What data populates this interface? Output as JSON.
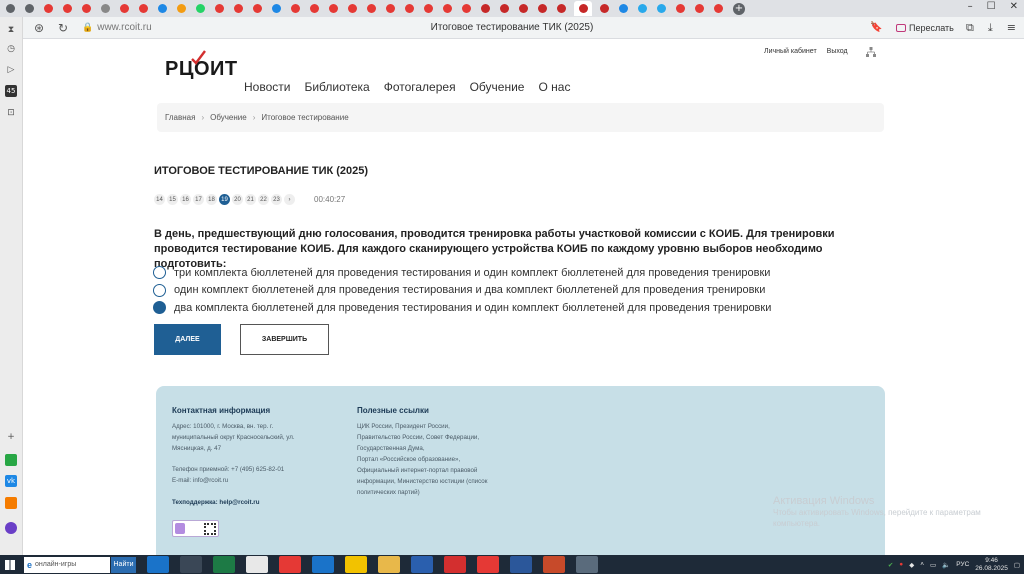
{
  "browser": {
    "tabs": [
      {
        "icon": "browser-logo-icon",
        "color": "#5f6368"
      },
      {
        "icon": "chevron-down-icon",
        "color": "#5f6368"
      },
      {
        "icon": "red-circle-icon",
        "color": "#e53935"
      },
      {
        "icon": "red-circle-icon",
        "color": "#e53935"
      },
      {
        "icon": "red-circle-icon",
        "color": "#e53935"
      },
      {
        "icon": "document-icon",
        "color": "#888888"
      },
      {
        "icon": "red-circle-icon",
        "color": "#e53935"
      },
      {
        "icon": "red-circle-icon",
        "color": "#e53935"
      },
      {
        "icon": "blue-globe-icon",
        "color": "#1e88e5"
      },
      {
        "icon": "orange-circle-icon",
        "color": "#f39c12"
      },
      {
        "icon": "whatsapp-icon",
        "color": "#25d366"
      },
      {
        "icon": "red-circle-icon",
        "color": "#e53935"
      },
      {
        "icon": "red-circle-icon",
        "color": "#e53935"
      },
      {
        "icon": "red-circle-icon",
        "color": "#e53935"
      },
      {
        "icon": "blue-globe-icon",
        "color": "#1e88e5"
      },
      {
        "icon": "red-circle-icon",
        "color": "#e53935"
      },
      {
        "icon": "red-circle-icon",
        "color": "#e53935"
      },
      {
        "icon": "red-circle-icon",
        "color": "#e53935"
      },
      {
        "icon": "red-circle-icon",
        "color": "#e53935"
      },
      {
        "icon": "red-circle-icon",
        "color": "#e53935"
      },
      {
        "icon": "red-circle-icon",
        "color": "#e53935"
      },
      {
        "icon": "yandex-icon",
        "color": "#e53935"
      },
      {
        "icon": "red-circle-icon",
        "color": "#e53935"
      },
      {
        "icon": "yandex-icon",
        "color": "#e53935"
      },
      {
        "icon": "red-circle-icon",
        "color": "#e53935"
      },
      {
        "icon": "rcoit-icon",
        "color": "#c62828"
      },
      {
        "icon": "rcoit-icon",
        "color": "#c62828"
      },
      {
        "icon": "rcoit-icon",
        "color": "#c62828"
      },
      {
        "icon": "rcoit-icon",
        "color": "#c62828"
      },
      {
        "icon": "rcoit-icon",
        "color": "#c62828"
      },
      {
        "icon": "rcoit-icon",
        "color": "#c62828",
        "active": true
      },
      {
        "icon": "rcoit-icon",
        "color": "#c62828"
      },
      {
        "icon": "blue-globe-icon",
        "color": "#1e88e5"
      },
      {
        "icon": "telegram-icon",
        "color": "#29a9eb"
      },
      {
        "icon": "telegram-icon",
        "color": "#29a9eb"
      },
      {
        "icon": "red-circle-icon",
        "color": "#e53935"
      },
      {
        "icon": "red-circle-icon",
        "color": "#e53935"
      },
      {
        "icon": "red-circle-icon",
        "color": "#e53935"
      }
    ],
    "url": "www.rcoit.ru",
    "page_title": "Итоговое тестирование ТИК (2025)",
    "resend_label": "Переслать"
  },
  "sidebar": {
    "items": [
      "history-icon",
      "clock-icon",
      "play-icon",
      "counter-icon",
      "bookmark-icon"
    ],
    "badge": "45"
  },
  "site": {
    "logo_text": "РЦОИТ",
    "nav": [
      "Новости",
      "Библиотека",
      "Фотогалерея",
      "Обучение",
      "О нас"
    ],
    "top_links": {
      "cabinet": "Личный кабинет",
      "logout": "Выход"
    },
    "breadcrumb": [
      "Главная",
      "Обучение",
      "Итоговое тестирование"
    ],
    "test_title": "ИТОГОВОЕ ТЕСТИРОВАНИЕ ТИК (2025)",
    "pager": {
      "pages": [
        "14",
        "15",
        "16",
        "17",
        "18",
        "19",
        "20",
        "21",
        "22",
        "23",
        "›"
      ],
      "current": "19",
      "timer": "00:40:27"
    },
    "question": "В день, предшествующий дню голосования, проводится тренировка работы участковой комиссии с КОИБ. Для тренировки проводится тестирование КОИБ. Для каждого сканирующего устройства КОИБ по каждому уровню выборов необходимо подготовить:",
    "options": [
      {
        "text": "три комплекта бюллетеней для проведения тестирования и один комплект бюллетеней для проведения тренировки",
        "checked": false
      },
      {
        "text": "один комплект бюллетеней для проведения тестирования и два комплект бюллетеней для проведения тренировки",
        "checked": false
      },
      {
        "text": "два комплекта бюллетеней для проведения тестирования и один комплект бюллетеней для проведения тренировки",
        "checked": true
      }
    ],
    "buttons": {
      "next": "ДАЛЕЕ",
      "finish": "ЗАВЕРШИТЬ"
    },
    "footer": {
      "contact_title": "Контактная информация",
      "address_lines": [
        "Адрес: 101000, г. Москва, вн. тер. г.",
        "муниципальный округ Красносельский, ул.",
        "Мясницкая, д. 47"
      ],
      "phone": "Телефон приемной: +7 (495) 625-82-01",
      "email": "E-mail: info@rcoit.ru",
      "support_label": "Техподдержка:",
      "support_email": "help@rcoit.ru",
      "links_title": "Полезные ссылки",
      "links_lines": [
        "ЦИК России, Президент России,",
        "Правительство России, Совет Федерации,",
        "Государственная Дума,",
        "Портал «Российское образование»,",
        "Официальный интернет-портал правовой",
        "информации, Министерство юстиции (список",
        "политических партий)"
      ]
    },
    "watermark": {
      "title": "Активация Windows",
      "text": "Чтобы активировать Windows, перейдите к параметрам компьютера."
    }
  },
  "taskbar": {
    "search_text": "онлайн-игры",
    "search_button": "Найти",
    "apps": [
      {
        "icon": "edge-icon",
        "color": "#1a73c9"
      },
      {
        "icon": "task-view-icon",
        "color": "#3a4756"
      },
      {
        "icon": "excel-icon",
        "color": "#1d7a45"
      },
      {
        "icon": "yandex-browser-icon",
        "color": "#e8e8e8"
      },
      {
        "icon": "yandex-icon",
        "color": "#e53935"
      },
      {
        "icon": "edge-icon",
        "color": "#1a73c9"
      },
      {
        "icon": "mail-icon",
        "color": "#f2c200"
      },
      {
        "icon": "folder-icon",
        "color": "#e8b84a"
      },
      {
        "icon": "monitor-icon",
        "color": "#2a5fae"
      },
      {
        "icon": "opera-icon",
        "color": "#d32f2f"
      },
      {
        "icon": "huawei-icon",
        "color": "#e53935"
      },
      {
        "icon": "word-icon",
        "color": "#2b579a"
      },
      {
        "icon": "powerpoint-icon",
        "color": "#c74a2a"
      },
      {
        "icon": "remote-desktop-icon",
        "color": "#5a6b7c"
      }
    ],
    "lang": "РУС",
    "time": "9:46",
    "date": "26.08.2025"
  }
}
